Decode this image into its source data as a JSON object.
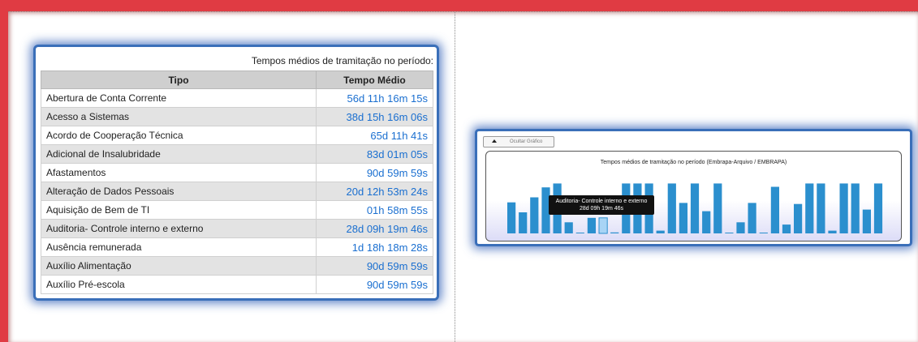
{
  "table": {
    "caption": "Tempos médios de tramitação no período:",
    "headers": [
      "Tipo",
      "Tempo Médio"
    ],
    "rows": [
      {
        "tipo": "Abertura de Conta Corrente",
        "tempo": "56d 11h 16m 15s"
      },
      {
        "tipo": "Acesso a Sistemas",
        "tempo": "38d 15h 16m 06s"
      },
      {
        "tipo": "Acordo de Cooperação Técnica",
        "tempo": "65d 11h 41s"
      },
      {
        "tipo": "Adicional de Insalubridade",
        "tempo": "83d 01m 05s"
      },
      {
        "tipo": "Afastamentos",
        "tempo": "90d 59m 59s"
      },
      {
        "tipo": "Alteração de Dados Pessoais",
        "tempo": "20d 12h 53m 24s"
      },
      {
        "tipo": "Aquisição de Bem de TI",
        "tempo": "01h 58m 55s"
      },
      {
        "tipo": "Auditoria- Controle interno e externo",
        "tempo": "28d 09h 19m 46s"
      },
      {
        "tipo": "Ausência remunerada",
        "tempo": "1d 18h 18m 28s"
      },
      {
        "tipo": "Auxílio Alimentação",
        "tempo": "90d 59m 59s"
      },
      {
        "tipo": "Auxílio Pré-escola",
        "tempo": "90d 59m 59s"
      }
    ]
  },
  "chart_panel": {
    "toggle_label": "Ocultar Gráfico",
    "toggle_icon": "triangle-up-icon",
    "tooltip_title": "Auditoria- Controle interno e externo",
    "tooltip_value": "28d 09h 19m 46s"
  },
  "colors": {
    "bar": "#2b8fce",
    "bar_highlight": "#a8d4f5",
    "time_text": "#1a6fd0",
    "frame_red": "#e03b43",
    "panel_glow": "#3a6fb9"
  },
  "chart_data": {
    "type": "bar",
    "title": "Tempos médios de tramitação no período (Embrapa-Arquivo / EMBRAPA)",
    "xlabel": "",
    "ylabel": "",
    "unit": "days",
    "highlight_index": 8,
    "values": [
      56,
      38,
      65,
      83,
      90,
      20,
      0.1,
      28,
      28,
      1.8,
      90,
      90,
      90,
      5,
      90,
      55,
      90,
      40,
      90,
      1,
      20,
      55,
      0.1,
      84,
      16,
      53,
      90,
      90,
      5,
      90,
      90,
      43,
      90
    ],
    "ylim": [
      0,
      95
    ]
  }
}
